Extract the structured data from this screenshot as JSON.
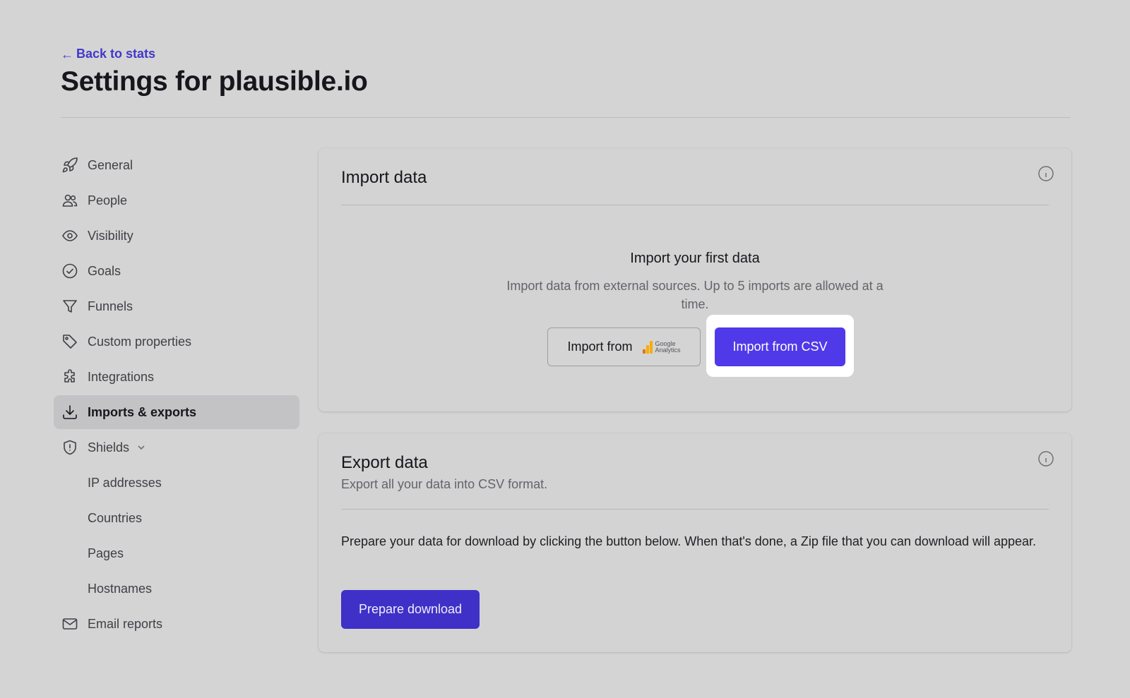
{
  "header": {
    "back_label": "Back to stats",
    "title": "Settings for plausible.io"
  },
  "sidebar": {
    "items": [
      {
        "label": "General",
        "icon": "rocket-icon"
      },
      {
        "label": "People",
        "icon": "people-icon"
      },
      {
        "label": "Visibility",
        "icon": "eye-icon"
      },
      {
        "label": "Goals",
        "icon": "check-circle-icon"
      },
      {
        "label": "Funnels",
        "icon": "funnel-icon"
      },
      {
        "label": "Custom properties",
        "icon": "tag-icon"
      },
      {
        "label": "Integrations",
        "icon": "puzzle-icon"
      },
      {
        "label": "Imports & exports",
        "icon": "download-icon",
        "active": true
      },
      {
        "label": "Shields",
        "icon": "shield-icon"
      },
      {
        "label": "IP addresses"
      },
      {
        "label": "Countries"
      },
      {
        "label": "Pages"
      },
      {
        "label": "Hostnames"
      },
      {
        "label": "Email reports",
        "icon": "envelope-icon"
      }
    ]
  },
  "import_card": {
    "title": "Import data",
    "empty_title": "Import your first data",
    "empty_desc": "Import data from external sources. Up to 5 imports are allowed at a time.",
    "ga_button_label": "Import from",
    "ga_logo_text_1": "Google",
    "ga_logo_text_2": "Analytics",
    "csv_button_label": "Import from CSV"
  },
  "export_card": {
    "title": "Export data",
    "subtitle": "Export all your data into CSV format.",
    "body": "Prepare your data for download by clicking the button below. When that's done, a Zip file that you can download will appear.",
    "prepare_button_label": "Prepare download"
  },
  "colors": {
    "accent": "#4f39e8",
    "link": "#4338ca",
    "ga_orange": "#f9ab00",
    "ga_dark_orange": "#e37400"
  }
}
